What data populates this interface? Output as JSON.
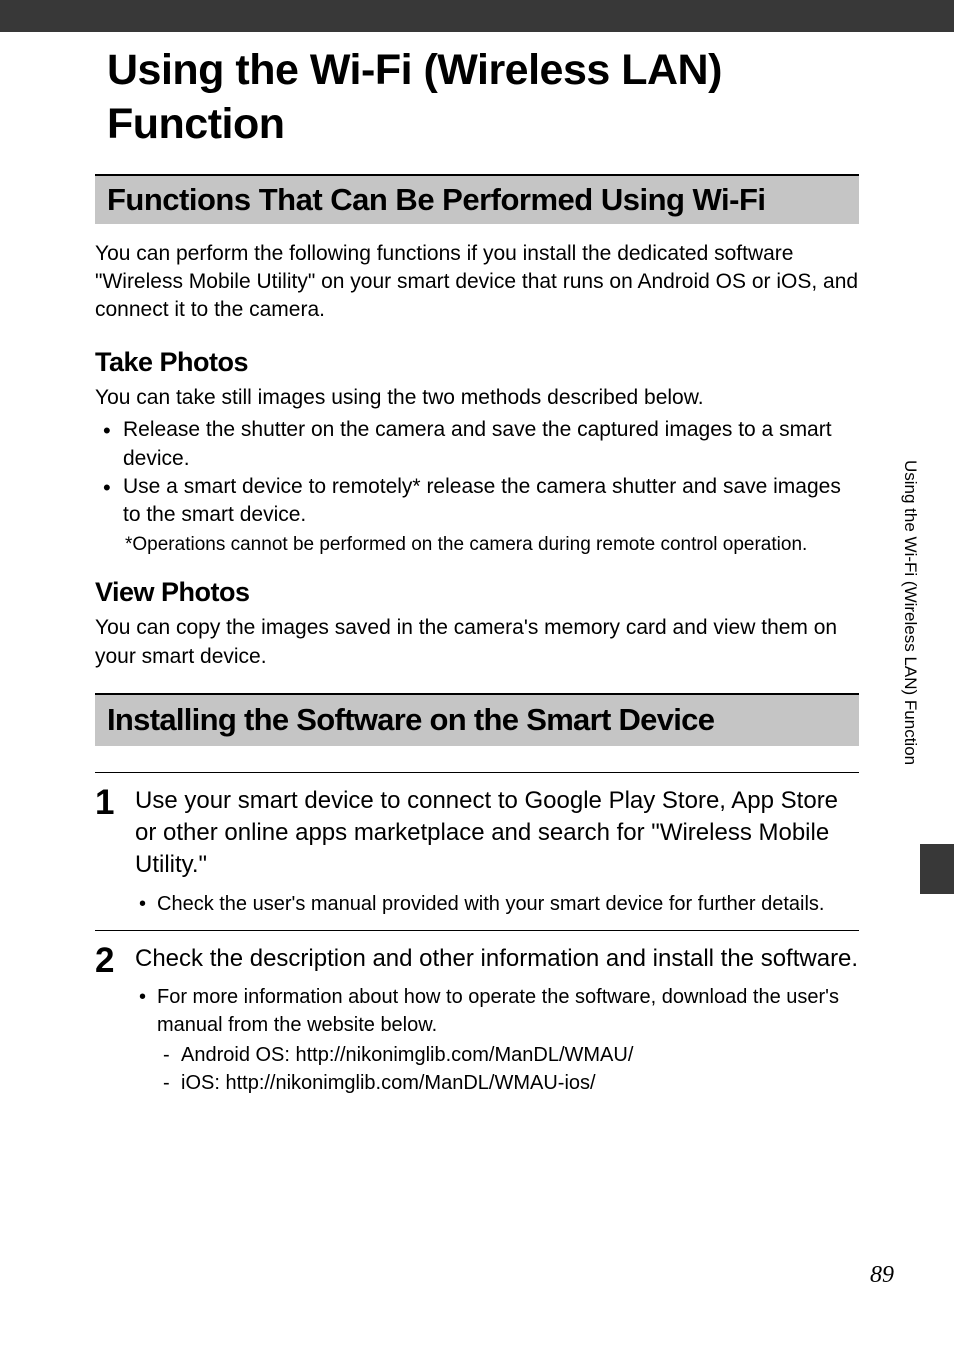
{
  "chapterTitle": "Using the Wi-Fi (Wireless LAN) Function",
  "section1": {
    "heading": "Functions That Can Be Performed Using Wi-Fi",
    "intro": "You can perform the following functions if you install the dedicated software \"Wireless Mobile Utility\" on your smart device that runs on Android OS or iOS, and connect it to the camera.",
    "sub1": {
      "heading": "Take Photos",
      "intro": "You can take still images using the two methods described below.",
      "bullets": [
        "Release the shutter on the camera and save the captured images to a smart device.",
        "Use a smart device to remotely* release the camera shutter and save images to the smart device."
      ],
      "footnote": "*Operations cannot be performed on the camera during remote control operation."
    },
    "sub2": {
      "heading": "View Photos",
      "body": "You can copy the images saved in the camera's memory card and view them on your smart device."
    }
  },
  "section2": {
    "heading": "Installing the Software on the Smart Device",
    "steps": [
      {
        "num": "1",
        "heading": "Use your smart device to connect to Google Play Store, App Store or other online apps marketplace and search for \"Wireless Mobile Utility.\"",
        "bullets": [
          "Check the user's manual provided with your smart device for further details."
        ]
      },
      {
        "num": "2",
        "heading": "Check the description and other information and install the software.",
        "bullets": [
          "For more information about how to operate the software, download the user's manual from the website below."
        ],
        "dashes": [
          "Android OS: http://nikonimglib.com/ManDL/WMAU/",
          "iOS: http://nikonimglib.com/ManDL/WMAU-ios/"
        ]
      }
    ]
  },
  "sideTab": "Using the Wi-Fi (Wireless LAN) Function",
  "pageNumber": "89"
}
